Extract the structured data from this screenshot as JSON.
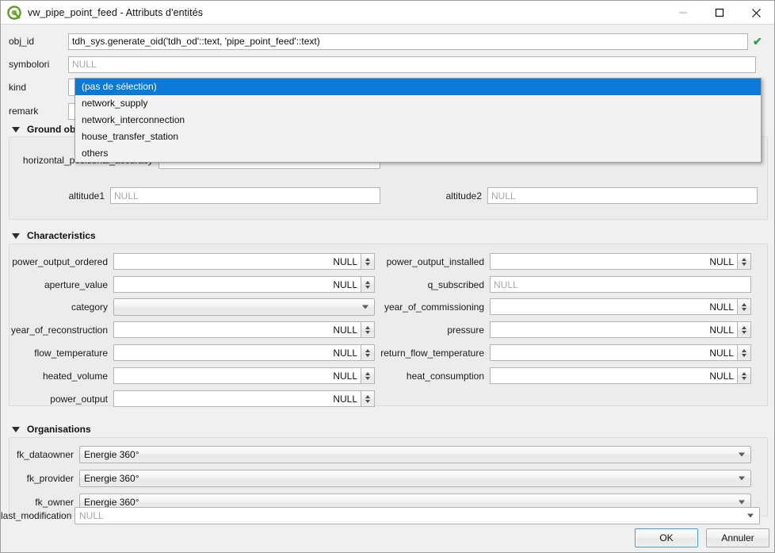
{
  "window": {
    "title": "vw_pipe_point_feed - Attributs d'entités",
    "icon": "qgis-logo-icon",
    "controls": {
      "minimize": "minimize-icon",
      "maximize": "maximize-icon",
      "close": "close-icon"
    }
  },
  "top_fields": [
    {
      "label": "obj_id",
      "value": "tdh_sys.generate_oid('tdh_od'::text, 'pipe_point_feed'::text)",
      "valid_mark": "✔"
    },
    {
      "label": "symbolori",
      "value": "NULL"
    },
    {
      "label": "kind",
      "value": ""
    },
    {
      "label": "remark",
      "value": ""
    }
  ],
  "kind_dropdown": {
    "open": true,
    "options": [
      "(pas de sélection)",
      "network_supply",
      "network_interconnection",
      "house_transfer_station",
      "others"
    ],
    "selected_index": 0
  },
  "groups": [
    {
      "title": "Ground observation",
      "fields": [
        {
          "label": "horizontal_positional_accuracy",
          "value": ""
        },
        {
          "label": "altitude1",
          "value": "NULL"
        },
        {
          "label": "altitude2",
          "value": "NULL"
        }
      ]
    },
    {
      "title": "Characteristics",
      "left_fields": [
        {
          "label": "power_output_ordered",
          "value": "NULL",
          "type": "spin"
        },
        {
          "label": "aperture_value",
          "value": "NULL",
          "type": "spin"
        },
        {
          "label": "category",
          "value": "",
          "type": "combo"
        },
        {
          "label": "year_of_reconstruction",
          "value": "NULL",
          "type": "spin"
        },
        {
          "label": "flow_temperature",
          "value": "NULL",
          "type": "spin"
        },
        {
          "label": "heated_volume",
          "value": "NULL",
          "type": "spin"
        },
        {
          "label": "power_output",
          "value": "NULL",
          "type": "spin"
        }
      ],
      "right_fields": [
        {
          "label": "power_output_installed",
          "value": "NULL",
          "type": "spin"
        },
        {
          "label": "q_subscribed",
          "value": "NULL",
          "type": "text"
        },
        {
          "label": "year_of_commissioning",
          "value": "NULL",
          "type": "spin"
        },
        {
          "label": "pressure",
          "value": "NULL",
          "type": "spin"
        },
        {
          "label": "return_flow_temperature",
          "value": "NULL",
          "type": "spin"
        },
        {
          "label": "heat_consumption",
          "value": "NULL",
          "type": "spin"
        }
      ]
    },
    {
      "title": "Organisations",
      "fields": [
        {
          "label": "fk_dataowner",
          "value": "Energie 360°"
        },
        {
          "label": "fk_provider",
          "value": "Energie 360°"
        },
        {
          "label": "fk_owner",
          "value": "Energie 360°"
        }
      ]
    }
  ],
  "last_modification": {
    "label": "last_modification",
    "value": "NULL"
  },
  "buttons": {
    "ok": "OK",
    "cancel": "Annuler"
  },
  "colors": {
    "accent": "#0a7ad6",
    "valid_check": "#2f9e44",
    "form_bg": "#f0f0f0",
    "panel_bg": "#ececec"
  }
}
